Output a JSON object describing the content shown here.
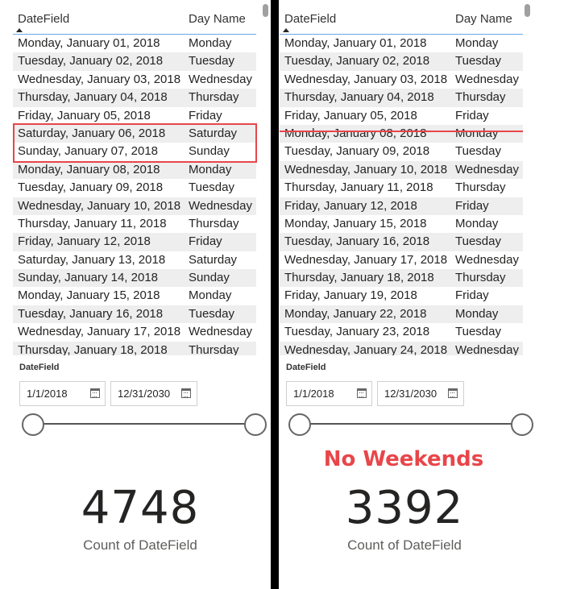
{
  "left": {
    "table": {
      "headers": {
        "date": "DateField",
        "day": "Day Name"
      },
      "rows": [
        {
          "date": "Monday, January 01, 2018",
          "day": "Monday"
        },
        {
          "date": "Tuesday, January 02, 2018",
          "day": "Tuesday"
        },
        {
          "date": "Wednesday, January 03, 2018",
          "day": "Wednesday"
        },
        {
          "date": "Thursday, January 04, 2018",
          "day": "Thursday"
        },
        {
          "date": "Friday, January 05, 2018",
          "day": "Friday"
        },
        {
          "date": "Saturday, January 06, 2018",
          "day": "Saturday"
        },
        {
          "date": "Sunday, January 07, 2018",
          "day": "Sunday"
        },
        {
          "date": "Monday, January 08, 2018",
          "day": "Monday"
        },
        {
          "date": "Tuesday, January 09, 2018",
          "day": "Tuesday"
        },
        {
          "date": "Wednesday, January 10, 2018",
          "day": "Wednesday"
        },
        {
          "date": "Thursday, January 11, 2018",
          "day": "Thursday"
        },
        {
          "date": "Friday, January 12, 2018",
          "day": "Friday"
        },
        {
          "date": "Saturday, January 13, 2018",
          "day": "Saturday"
        },
        {
          "date": "Sunday, January 14, 2018",
          "day": "Sunday"
        },
        {
          "date": "Monday, January 15, 2018",
          "day": "Monday"
        },
        {
          "date": "Tuesday, January 16, 2018",
          "day": "Tuesday"
        },
        {
          "date": "Wednesday, January 17, 2018",
          "day": "Wednesday"
        },
        {
          "date": "Thursday, January 18, 2018",
          "day": "Thursday"
        }
      ]
    },
    "slicer": {
      "title": "DateField",
      "start": "1/1/2018",
      "end": "12/31/2030",
      "range_fraction": [
        0,
        1
      ]
    },
    "card": {
      "value": "4748",
      "label": "Count of DateField"
    }
  },
  "right": {
    "table": {
      "headers": {
        "date": "DateField",
        "day": "Day Name"
      },
      "rows": [
        {
          "date": "Monday, January 01, 2018",
          "day": "Monday"
        },
        {
          "date": "Tuesday, January 02, 2018",
          "day": "Tuesday"
        },
        {
          "date": "Wednesday, January 03, 2018",
          "day": "Wednesday"
        },
        {
          "date": "Thursday, January 04, 2018",
          "day": "Thursday"
        },
        {
          "date": "Friday, January 05, 2018",
          "day": "Friday"
        },
        {
          "date": "Monday, January 08, 2018",
          "day": "Monday"
        },
        {
          "date": "Tuesday, January 09, 2018",
          "day": "Tuesday"
        },
        {
          "date": "Wednesday, January 10, 2018",
          "day": "Wednesday"
        },
        {
          "date": "Thursday, January 11, 2018",
          "day": "Thursday"
        },
        {
          "date": "Friday, January 12, 2018",
          "day": "Friday"
        },
        {
          "date": "Monday, January 15, 2018",
          "day": "Monday"
        },
        {
          "date": "Tuesday, January 16, 2018",
          "day": "Tuesday"
        },
        {
          "date": "Wednesday, January 17, 2018",
          "day": "Wednesday"
        },
        {
          "date": "Thursday, January 18, 2018",
          "day": "Thursday"
        },
        {
          "date": "Friday, January 19, 2018",
          "day": "Friday"
        },
        {
          "date": "Monday, January 22, 2018",
          "day": "Monday"
        },
        {
          "date": "Tuesday, January 23, 2018",
          "day": "Tuesday"
        },
        {
          "date": "Wednesday, January 24, 2018",
          "day": "Wednesday"
        }
      ]
    },
    "slicer": {
      "title": "DateField",
      "start": "1/1/2018",
      "end": "12/31/2030",
      "range_fraction": [
        0,
        1
      ]
    },
    "annotation": "No Weekends",
    "card": {
      "value": "3392",
      "label": "Count of DateField"
    }
  },
  "colors": {
    "highlight": "#e8464a",
    "header_underline": "#6aa8e8",
    "row_band": "#eeeeee",
    "divider": "#000000"
  },
  "icons": {
    "calendar": "calendar-icon",
    "sort": "sort-ascending-icon"
  }
}
